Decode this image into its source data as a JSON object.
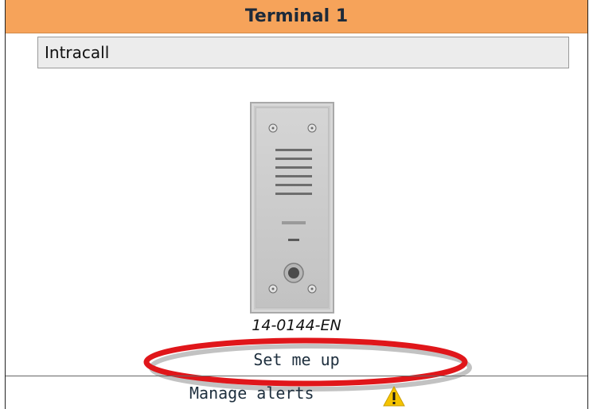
{
  "window": {
    "title": "Terminal 1"
  },
  "terminal": {
    "name_value": "Intracall",
    "model": "14-0144-EN",
    "device_image": "intercom-panel"
  },
  "actions": {
    "setup_label": "Set me up",
    "manage_alerts_label": "Manage alerts"
  },
  "icons": {
    "alert": "warning-icon"
  },
  "colors": {
    "title_bar": "#f6a35a",
    "highlight_ring": "#e0161a",
    "warning": "#f5c400"
  }
}
